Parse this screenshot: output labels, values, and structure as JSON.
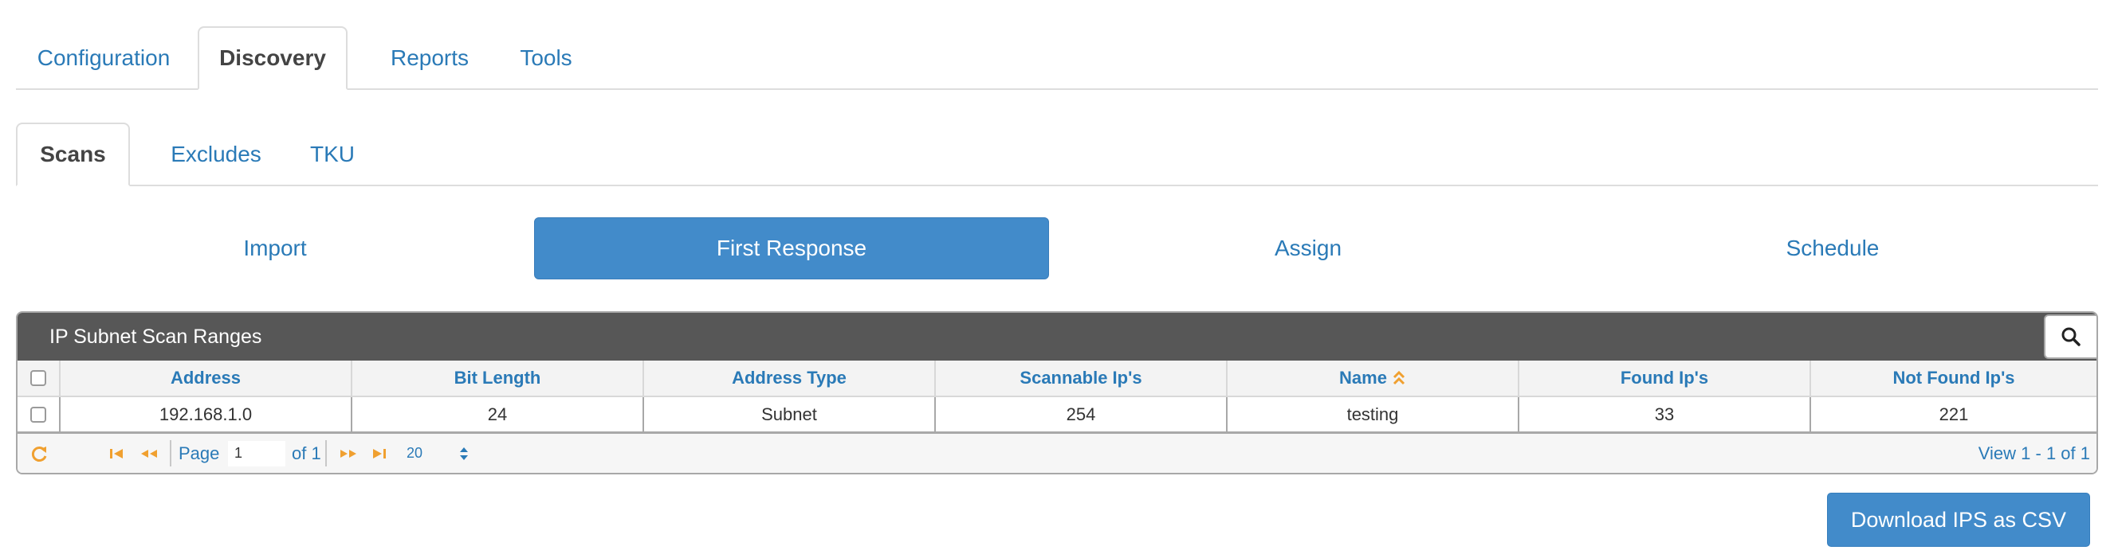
{
  "main_tabs": [
    {
      "label": "Configuration"
    },
    {
      "label": "Discovery"
    },
    {
      "label": "Reports"
    },
    {
      "label": "Tools"
    }
  ],
  "sub_tabs": [
    {
      "label": "Scans"
    },
    {
      "label": "Excludes"
    },
    {
      "label": "TKU"
    }
  ],
  "pills": [
    {
      "label": "Import"
    },
    {
      "label": "First Response"
    },
    {
      "label": "Assign"
    },
    {
      "label": "Schedule"
    }
  ],
  "grid": {
    "caption": "IP Subnet Scan Ranges",
    "columns": [
      "Address",
      "Bit Length",
      "Address Type",
      "Scannable Ip's",
      "Name",
      "Found Ip's",
      "Not Found Ip's"
    ],
    "sorted_column": "Name",
    "rows": [
      [
        "192.168.1.0",
        "24",
        "Subnet",
        "254",
        "testing",
        "33",
        "221"
      ]
    ]
  },
  "pager": {
    "page_label": "Page",
    "page_value": "1",
    "of_label": "of 1",
    "rows_per_page": "20",
    "view_text": "View 1 - 1 of 1"
  },
  "download_button": "Download IPS as CSV",
  "colors": {
    "accent": "#428bca",
    "link": "#2a7ab7",
    "caption_bg": "#575757",
    "pager_icon": "#f0a030"
  },
  "icons": {
    "search": "search-icon",
    "refresh": "refresh-icon",
    "first": "first-page-icon",
    "prev": "prev-page-icon",
    "next": "next-page-icon",
    "last": "last-page-icon",
    "sort": "sort-icon"
  }
}
